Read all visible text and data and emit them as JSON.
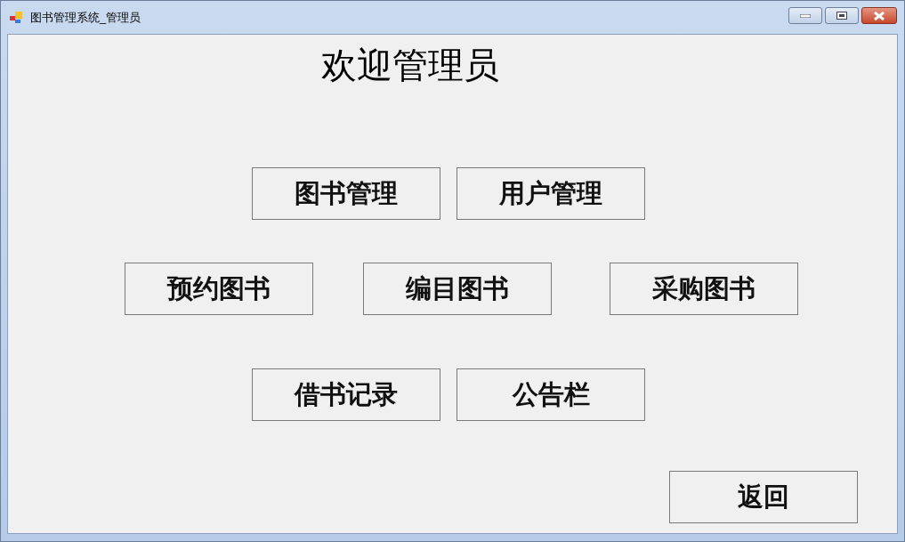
{
  "window": {
    "title": "图书管理系统_管理员"
  },
  "heading": "欢迎管理员",
  "button_rows": [
    [
      "图书管理",
      "用户管理"
    ],
    [
      "预约图书",
      "编目图书",
      "采购图书"
    ],
    [
      "借书记录",
      "公告栏"
    ]
  ],
  "back_button": "返回"
}
